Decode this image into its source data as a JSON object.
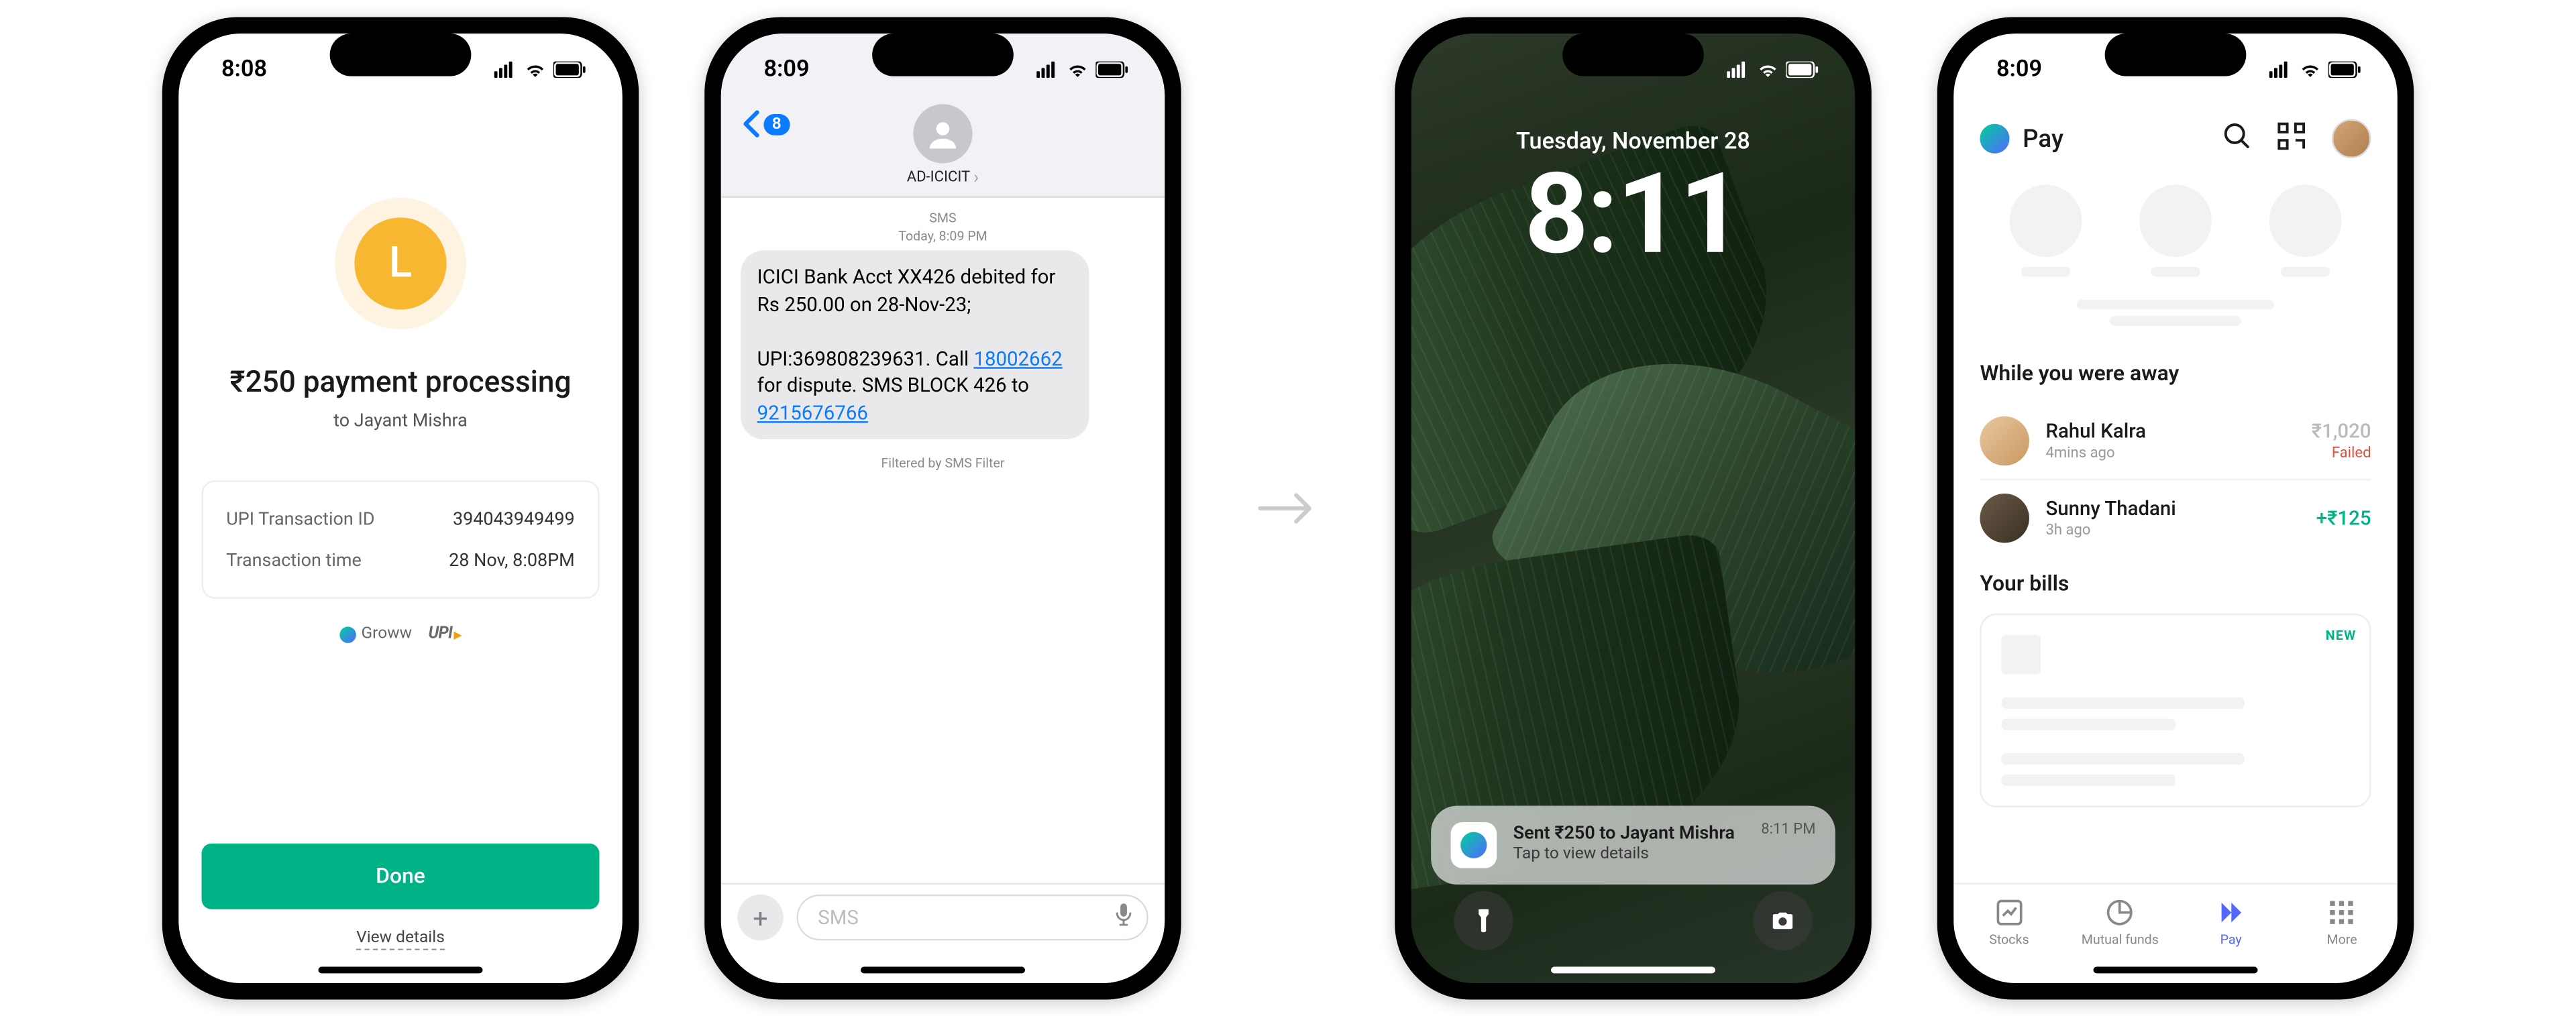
{
  "phone1": {
    "status_time": "8:08",
    "icon_letter": "L",
    "title": "₹250 payment processing",
    "subtitle": "to Jayant Mishra",
    "rows": [
      {
        "label": "UPI Transaction ID",
        "value": "394043949499"
      },
      {
        "label": "Transaction time",
        "value": "28 Nov, 8:08PM"
      }
    ],
    "brand1": "Groww",
    "brand2": "UPI",
    "done": "Done",
    "view": "View details"
  },
  "phone2": {
    "status_time": "8:09",
    "back_badge": "8",
    "contact": "AD-ICICIT",
    "meta_line1": "SMS",
    "meta_line2": "Today, 8:09 PM",
    "msg_pre": "ICICI Bank Acct XX426 debited for Rs 250.00 on 28-Nov-23;\n\nUPI:369808239631. Call ",
    "link1": "18002662",
    "msg_mid": " for dispute. SMS BLOCK 426 to ",
    "link2": "9215676766",
    "filter": "Filtered by SMS Filter",
    "placeholder": "SMS"
  },
  "phone3": {
    "status_time": "8:11",
    "date": "Tuesday, November 28",
    "time": "8:11",
    "notif_title": "Sent ₹250 to Jayant Mishra",
    "notif_sub": "Tap to view details",
    "notif_time": "8:11 PM"
  },
  "phone4": {
    "status_time": "8:09",
    "title": "Pay",
    "section_away": "While you were away",
    "items": [
      {
        "name": "Rahul Kalra",
        "time": "4mins ago",
        "amount": "₹1,020",
        "status": "Failed",
        "cls": "failed"
      },
      {
        "name": "Sunny Thadani",
        "time": "3h ago",
        "amount": "+₹125",
        "status": "",
        "cls": "succ"
      }
    ],
    "section_bills": "Your bills",
    "new_badge": "NEW",
    "tabs": [
      {
        "label": "Stocks"
      },
      {
        "label": "Mutual funds"
      },
      {
        "label": "Pay"
      },
      {
        "label": "More"
      }
    ]
  }
}
